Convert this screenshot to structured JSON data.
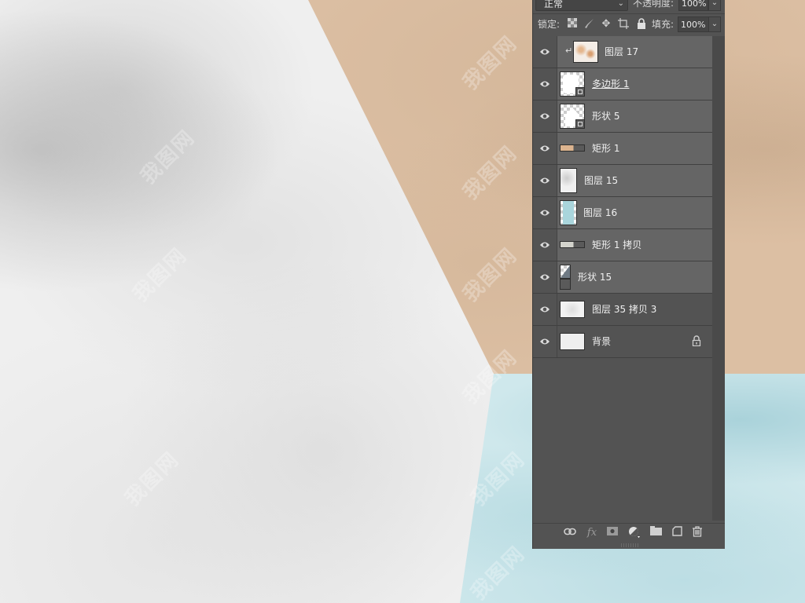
{
  "canvas": {
    "colors": {
      "grey_marble": "#efefef",
      "beige": "#dcbfa3",
      "blue_marble": "#cfe8ec"
    },
    "watermark_text": "我图网"
  },
  "layers_panel": {
    "blend_mode": "正常",
    "opacity_label": "不透明度:",
    "opacity_value": "100%",
    "lock_label": "锁定:",
    "lock_icons": [
      "lock-transparent-pixels-icon",
      "lock-image-pixels-icon",
      "lock-position-icon",
      "lock-artboard-icon",
      "lock-all-icon"
    ],
    "fill_label": "填充:",
    "fill_value": "100%",
    "layers": [
      {
        "name": "图层 17",
        "visible": true,
        "clipped": true,
        "thumb": "beige-marble"
      },
      {
        "name": "多边形 1",
        "visible": true,
        "thumb": "shape-mask"
      },
      {
        "name": "形状 5",
        "visible": true,
        "thumb": "shape-mask"
      },
      {
        "name": "矩形 1",
        "visible": true,
        "thumb": "beige-rect"
      },
      {
        "name": "图层 15",
        "visible": true,
        "thumb": "grey-marble"
      },
      {
        "name": "图层 16",
        "visible": true,
        "thumb": "blue-marble"
      },
      {
        "name": "矩形 1 拷贝",
        "visible": true,
        "thumb": "grey-rect"
      },
      {
        "name": "形状 15",
        "visible": true,
        "thumb": "shape-diag"
      },
      {
        "name": "图层 35 拷贝 3",
        "visible": true,
        "thumb": "grey-marble-wide"
      },
      {
        "name": "背景",
        "visible": true,
        "locked": true,
        "thumb": "white"
      }
    ],
    "bottom_icons": [
      "link-layers-icon",
      "fx-icon",
      "add-mask-icon",
      "adjustment-layer-icon",
      "new-group-icon",
      "new-layer-icon",
      "delete-icon"
    ]
  }
}
